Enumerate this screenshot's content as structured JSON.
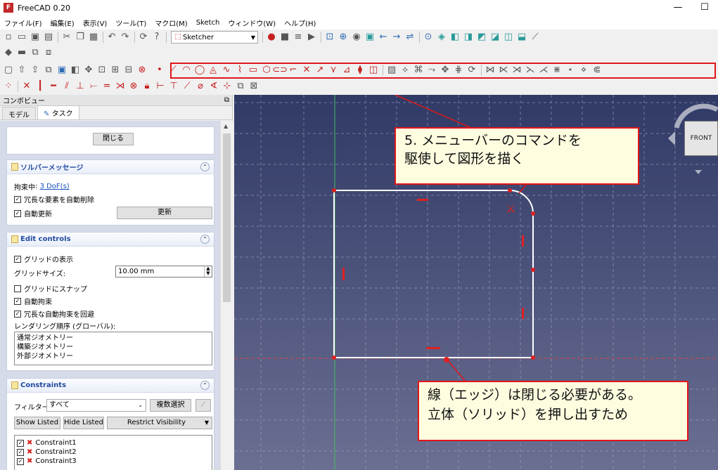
{
  "window": {
    "title": "FreeCAD 0.20",
    "minimize": "—",
    "maximize": "☐"
  },
  "menu": [
    "ファイル(F)",
    "編集(E)",
    "表示(V)",
    "ツール(T)",
    "マクロ(M)",
    "Sketch",
    "ウィンドウ(W)",
    "ヘルプ(H)"
  ],
  "toolbar": {
    "workbench": "Sketcher"
  },
  "panel": {
    "title": "コンボビュー",
    "tabs": [
      "モデル",
      "タスク"
    ],
    "close_label": "閉じる",
    "solver": {
      "title": "ソルバーメッセージ",
      "status_prefix": "拘束中",
      "dof_link": "3 DoF(s)",
      "auto_remove_redundant": "冗長な要素を自動削除",
      "auto_update": "自動更新",
      "update_button": "更新"
    },
    "edit": {
      "title": "Edit controls",
      "show_grid": "グリッドの表示",
      "grid_size_label": "グリッドサイズ:",
      "grid_size_value": "10.00 mm",
      "snap_grid": "グリッドにスナップ",
      "auto_constraints": "自動拘束",
      "avoid_redundant": "冗長な自動拘束を回避",
      "render_order_label": "レンダリング順序 (グローバル):",
      "render_order": [
        "通常ジオメトリー",
        "構築ジオメトリー",
        "外部ジオメトリー"
      ]
    },
    "constraints": {
      "title": "Constraints",
      "filter_label": "フィルター:",
      "filter_value": "すべて",
      "multi_select": "複数選択",
      "show_listed": "Show Listed",
      "hide_listed": "Hide Listed",
      "restrict_visibility": "Restrict Visibility",
      "items": [
        "Constraint1",
        "Constraint2",
        "Constraint3"
      ]
    }
  },
  "view": {
    "cube_face": "FRONT"
  },
  "callouts": {
    "top": [
      "5. メニューバーのコマンドを",
      "駆使して図形を描く"
    ],
    "bottom": [
      "線（エッジ）は閉じる必要がある。",
      "立体（ソリッド）を押し出すため"
    ]
  },
  "colors": {
    "annotation": "#e0161b",
    "constraint": "#e02020"
  }
}
